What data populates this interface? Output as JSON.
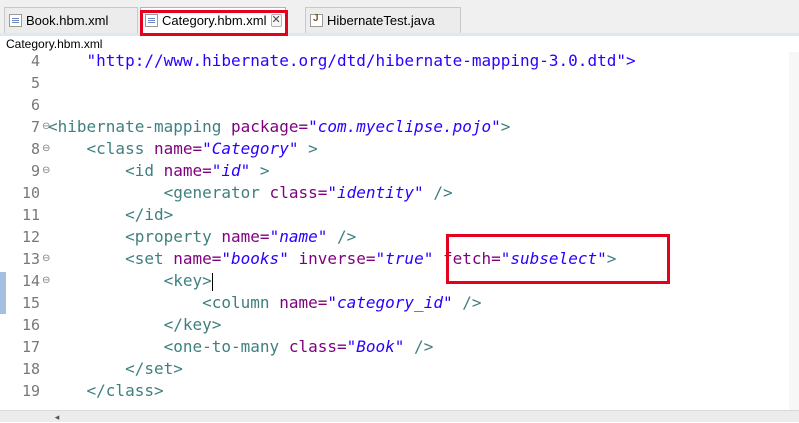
{
  "tabs": [
    {
      "label": "Book.hbm.xml",
      "icon": "xml-file-icon"
    },
    {
      "label": "Category.hbm.xml",
      "icon": "xml-file-icon",
      "active": true,
      "close": "✕"
    },
    {
      "label": "HibernateTest.java",
      "icon": "java-file-icon"
    }
  ],
  "breadcrumb": "Category.hbm.xml",
  "line_numbers": [
    "4",
    "5",
    "6",
    "7",
    "8",
    "9",
    "10",
    "11",
    "12",
    "13",
    "14",
    "15",
    "16",
    "17",
    "18",
    "19"
  ],
  "fold_markers": [
    "⊖",
    "⊖",
    "⊖",
    "⊖",
    "⊖"
  ],
  "code": {
    "l4": {
      "dtd": "    \"http://www.hibernate.org/dtd/hibernate-mapping-3.0.dtd\">"
    },
    "l7": {
      "open": "<hibernate-mapping",
      "attr": " package=",
      "val": "\"com.myeclipse.pojo\"",
      "close": ">"
    },
    "l8": {
      "open": "    <class",
      "attr": " name=",
      "val": "\"Category\"",
      "close": " >"
    },
    "l9": {
      "open": "        <id",
      "attr": " name=",
      "val": "\"id\"",
      "close": " >"
    },
    "l10": {
      "open": "            <generator",
      "attr": " class=",
      "val": "\"identity\"",
      "close": " />"
    },
    "l11": {
      "open": "        </id>"
    },
    "l12": {
      "open": "        <property",
      "attr": " name=",
      "val": "\"name\"",
      "close": " />"
    },
    "l13": {
      "open": "        <set",
      "attr1": " name=",
      "val1": "\"books\"",
      "attr2": " inverse=",
      "val2": "\"true\"",
      "attr3": " fetch=",
      "val3": "\"subselect\"",
      "close": ">"
    },
    "l14": {
      "open": "            <key>"
    },
    "l15": {
      "open": "                <column",
      "attr": " name=",
      "val": "\"category_id\"",
      "close": " />"
    },
    "l16": {
      "open": "            </key>"
    },
    "l17": {
      "open": "            <one-to-many",
      "attr": " class=",
      "val": "\"Book\"",
      "close": " />"
    },
    "l18": {
      "open": "        </set>"
    },
    "l19": {
      "open": "    </class>"
    }
  },
  "colors": {
    "highlight": "#e5001e",
    "tag": "#3f7f7f",
    "attribute": "#7f007f",
    "value": "#2a00ff"
  }
}
